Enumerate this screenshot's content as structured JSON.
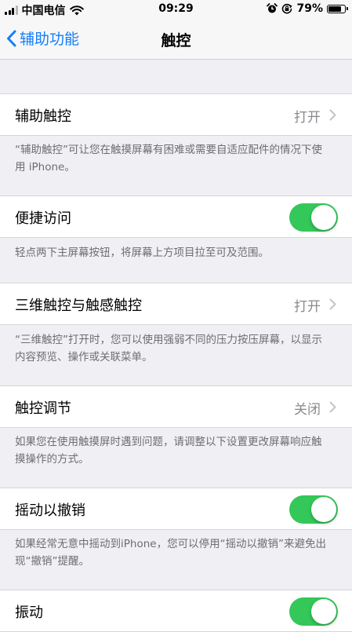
{
  "status_bar": {
    "carrier": "中国电信",
    "time": "09:29",
    "battery_percent": "79%",
    "battery_level": 0.79,
    "icons": [
      "signal-icon",
      "wifi-icon",
      "alarm-icon",
      "orientation-lock-icon",
      "battery-icon"
    ]
  },
  "nav": {
    "back_label": "辅助功能",
    "title": "触控"
  },
  "rows": {
    "assistive_touch": {
      "label": "辅助触控",
      "value": "打开"
    },
    "assistive_touch_footer": "“辅助触控”可让您在触摸屏幕有困难或需要自适应配件的情况下使用 iPhone。",
    "reachability": {
      "label": "便捷访问",
      "on": true
    },
    "reachability_footer": "轻点两下主屏幕按钮，将屏幕上方项目拉至可及范围。",
    "touch_3d": {
      "label": "三维触控与触感触控",
      "value": "打开"
    },
    "touch_3d_footer": "“三维触控”打开时，您可以使用强弱不同的压力按压屏幕，以显示内容预览、操作或关联菜单。",
    "touch_accommodations": {
      "label": "触控调节",
      "value": "关闭"
    },
    "touch_accommodations_footer": "如果您在使用触摸屏时遇到问题，请调整以下设置更改屏幕响应触摸操作的方式。",
    "shake_to_undo": {
      "label": "摇动以撤销",
      "on": true
    },
    "shake_to_undo_footer": "如果经常无意中摇动到iPhone，您可以停用“摇动以撤销”来避免出现“撤销”提醒。",
    "vibration": {
      "label": "振动",
      "on": true
    }
  },
  "colors": {
    "accent": "#147efb",
    "switch_on": "#34c759",
    "background": "#efeff4",
    "secondary_text": "#8a8a8e"
  }
}
